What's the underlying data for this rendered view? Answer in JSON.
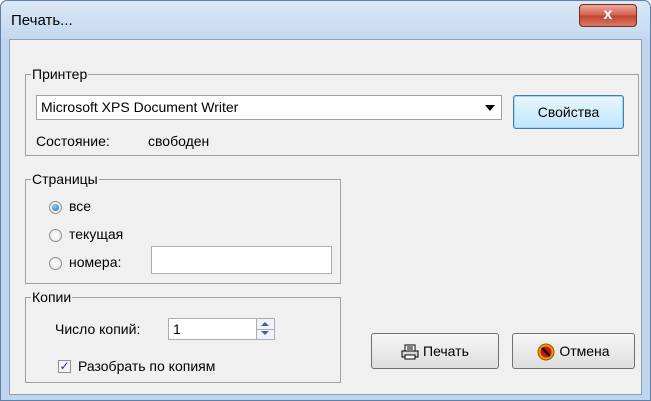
{
  "window": {
    "title": "Печать...",
    "close_glyph": "x"
  },
  "printer_group": {
    "legend": "Принтер",
    "selected_printer": "Microsoft XPS Document Writer",
    "properties_button": "Свойства",
    "status_label": "Состояние:",
    "status_value": "свободен"
  },
  "pages_group": {
    "legend": "Страницы",
    "options": [
      {
        "label": "все",
        "selected": true
      },
      {
        "label": "текущая",
        "selected": false
      },
      {
        "label": "номера:",
        "selected": false
      }
    ],
    "page_numbers_value": ""
  },
  "copies_group": {
    "legend": "Копии",
    "copies_label": "Число копий:",
    "copies_value": "1",
    "collate_label": "Разобрать по копиям",
    "collate_checked": true
  },
  "actions": {
    "print_button": "Печать",
    "cancel_button": "Отмена",
    "print_icon": "printer-icon",
    "cancel_icon": "stop-icon"
  },
  "colors": {
    "title_bar": "#c4d8f0",
    "close_button": "#c24430",
    "dialog_bg": "#f0f0f0"
  }
}
